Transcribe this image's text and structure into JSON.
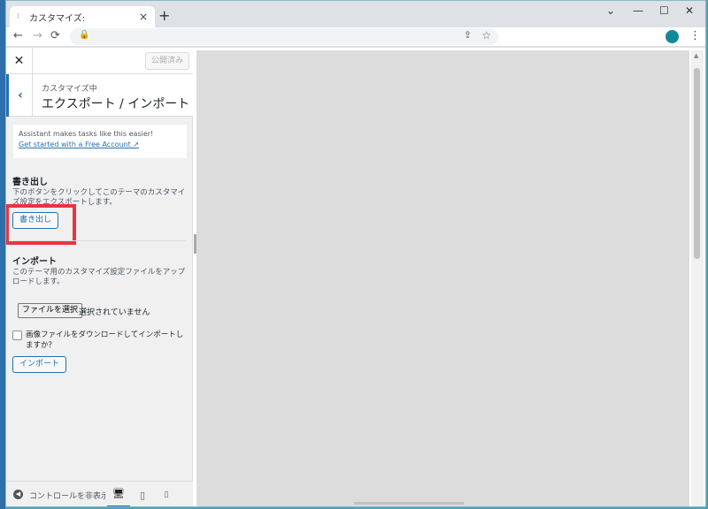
{
  "browser": {
    "tab_title": "カスタマイズ:",
    "tab_close": "×",
    "new_tab": "+",
    "win_minimize": "⌄",
    "win_restore": "—",
    "win_max": "☐",
    "win_close": "✕",
    "nav_back": "←",
    "nav_forward": "→",
    "nav_reload": "⟳",
    "lock": "🔒",
    "share": "⇪",
    "star": "☆",
    "menu": "⋮"
  },
  "customizer": {
    "close": "✕",
    "publish_label": "公開済み",
    "back": "‹",
    "breadcrumb": "カスタマイズ中",
    "panel_title": "エクスポート / インポート",
    "notice_text": "Assistant makes tasks like this easier!",
    "notice_link": "Get started with a Free Account ↗",
    "export": {
      "heading": "書き出し",
      "description": "下のボタンをクリックしてこのテーマのカスタマイズ設定をエクスポートします。",
      "button": "書き出し"
    },
    "import": {
      "heading": "インポート",
      "description": "このテーマ用のカスタマイズ設定ファイルをアップロードします。",
      "file_button": "ファイルを選択",
      "file_status": "選択されていません",
      "checkbox_label": "画像ファイルをダウンロードしてインポートしますか？",
      "button": "インポート"
    },
    "footer": {
      "collapse_icon": "◀",
      "collapse_label": "コントロールを非表示",
      "desktop": "🖥",
      "tablet": "▯",
      "mobile": "▯"
    }
  },
  "colors": {
    "accent": "#2271b1",
    "highlight": "#e8353f",
    "profile": "#0f8a99"
  }
}
